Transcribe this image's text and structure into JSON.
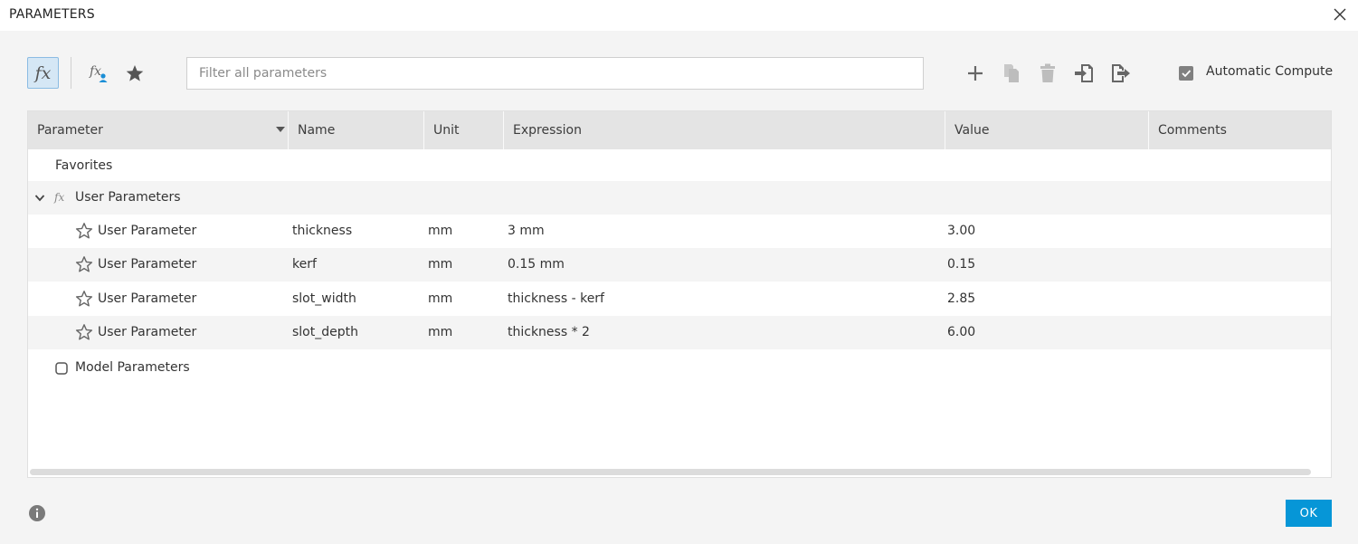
{
  "window": {
    "title": "PARAMETERS"
  },
  "toolbar": {
    "fx_label": "fx",
    "search_placeholder": "Filter all parameters",
    "automatic_compute_label": "Automatic Compute",
    "automatic_compute_checked": true
  },
  "table": {
    "headers": [
      "Parameter",
      "Name",
      "Unit",
      "Expression",
      "Value",
      "Comments"
    ],
    "groups": {
      "favorites": "Favorites",
      "user_parameters": "User Parameters",
      "model_parameters": "Model Parameters"
    },
    "rows": [
      {
        "parameter": "User Parameter",
        "name": "thickness",
        "unit": "mm",
        "expression": "3 mm",
        "value": "3.00",
        "comments": ""
      },
      {
        "parameter": "User Parameter",
        "name": "kerf",
        "unit": "mm",
        "expression": "0.15 mm",
        "value": "0.15",
        "comments": ""
      },
      {
        "parameter": "User Parameter",
        "name": "slot_width",
        "unit": "mm",
        "expression": "thickness - kerf",
        "value": "2.85",
        "comments": ""
      },
      {
        "parameter": "User Parameter",
        "name": "slot_depth",
        "unit": "mm",
        "expression": "thickness * 2",
        "value": "6.00",
        "comments": ""
      }
    ]
  },
  "footer": {
    "ok_label": "OK"
  },
  "icons": {
    "close": "close-icon",
    "fx": "function-icon",
    "fx_user": "user-function-icon",
    "star": "star-icon",
    "add": "plus-icon",
    "copy": "copy-icon",
    "delete": "trash-icon",
    "import": "import-icon",
    "export": "export-icon",
    "info": "info-icon"
  },
  "colors": {
    "accent": "#0696d7",
    "fx_button_bg": "#d5e7f5",
    "header_bg": "#e4e4e4"
  }
}
